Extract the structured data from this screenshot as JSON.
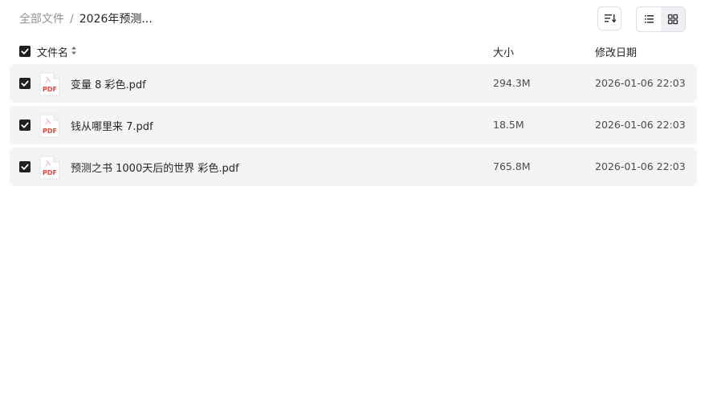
{
  "breadcrumb": {
    "root": "全部文件",
    "separator": "/",
    "current": "2026年预测..."
  },
  "toolbar": {
    "sort_icon": "sort-icon",
    "list_view_icon": "list-view-icon",
    "grid_view_icon": "grid-view-icon",
    "active_view": "list"
  },
  "table": {
    "header": {
      "name": "文件名",
      "size": "大小",
      "date": "修改日期",
      "select_all_checked": true
    },
    "rows": [
      {
        "name": "变量 8 彩色.pdf",
        "size": "294.3M",
        "date": "2026-01-06 22:03",
        "checked": true,
        "icon": "pdf-file-icon",
        "icon_label": "PDF"
      },
      {
        "name": "钱从哪里来 7.pdf",
        "size": "18.5M",
        "date": "2026-01-06 22:03",
        "checked": true,
        "icon": "pdf-file-icon",
        "icon_label": "PDF"
      },
      {
        "name": "预测之书 1000天后的世界 彩色.pdf",
        "size": "765.8M",
        "date": "2026-01-06 22:03",
        "checked": true,
        "icon": "pdf-file-icon",
        "icon_label": "PDF"
      }
    ]
  },
  "colors": {
    "row_bg": "#f4f4f5",
    "checkbox": "#1f1f24",
    "pdf_red": "#e0463f"
  }
}
